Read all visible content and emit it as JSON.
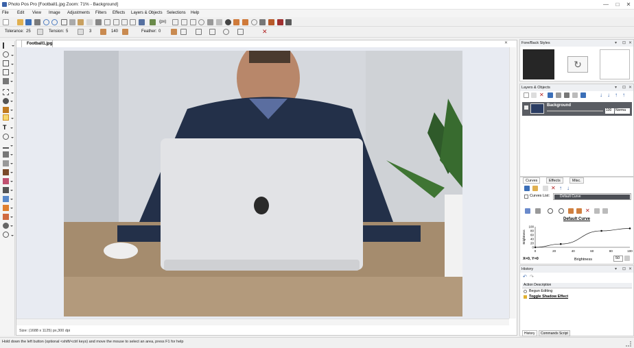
{
  "window": {
    "title": "Photo Pos Pro [Football1.jpg Zoom: 71% - Background]",
    "min": "—",
    "max": "□",
    "close": "✕"
  },
  "menu": [
    "File",
    "Edit",
    "View",
    "Image",
    "Adjustments",
    "Filters",
    "Effects",
    "Layers & Objects",
    "Selections",
    "Help"
  ],
  "options": {
    "tolerance_label": "Tolerance:",
    "tolerance": "25",
    "tension_label": "Tension:",
    "tension": "5",
    "value3": "3",
    "value140": "140",
    "feather_label": "Feather:",
    "feather": "0"
  },
  "toolbar_misc": {
    "pixel_label": "(px)"
  },
  "document": {
    "tab": "Football1.jpg",
    "size_info": "Size: (1688 x 1125) px,300 dpi"
  },
  "status": "Hold down the left button (optional <shift/<ctrl keys) and move the mouse to select an area, press F1 for help",
  "panels": {
    "foreback": {
      "title": "Fore/Back Styles",
      "fore_color": "#262626",
      "back_color": "#ffffff",
      "swap_icon": "↻"
    },
    "layers": {
      "title": "Layers & Objects",
      "layer_name": "Background",
      "opacity": "100",
      "blend": "Norma"
    },
    "curves": {
      "tabs": [
        "Curves",
        "Effects",
        "Misc."
      ],
      "list_label": "Curves List:",
      "selected": "Default Curve",
      "chart_title": "Default Curve",
      "coords": "X=0, Y=0",
      "xlabel": "Brightness",
      "value": "50"
    },
    "history": {
      "title": "History",
      "header": "Action Description",
      "items": [
        "Begun Editing",
        "Toggle Shadow Effect"
      ],
      "tabs": [
        "History",
        "Commands Script"
      ]
    }
  },
  "chart_data": {
    "type": "line",
    "title": "Default Curve",
    "xlabel": "Brightness",
    "ylabel": "Brightness",
    "xlim": [
      0,
      100
    ],
    "ylim": [
      0,
      100
    ],
    "xticks": [
      "0",
      "20",
      "40",
      "60",
      "80",
      "100"
    ],
    "yticks": [
      "0",
      "20",
      "40",
      "60",
      "80",
      "100"
    ],
    "points": [
      {
        "x": 0,
        "y": 0
      },
      {
        "x": 27,
        "y": 16
      },
      {
        "x": 70,
        "y": 80
      },
      {
        "x": 100,
        "y": 92
      }
    ]
  }
}
